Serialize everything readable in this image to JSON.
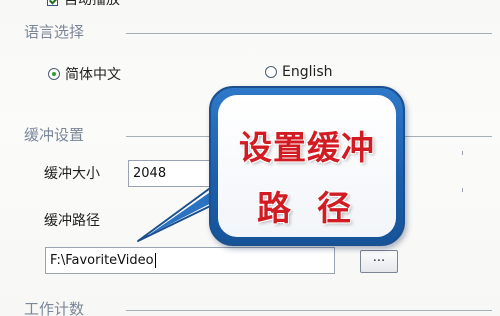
{
  "settings": {
    "top_option": {
      "label": "自动播放"
    },
    "language": {
      "header": "语言选择",
      "options": [
        {
          "label": "简体中文",
          "selected": true
        },
        {
          "label": "English",
          "selected": false
        }
      ]
    },
    "buffer": {
      "header": "缓冲设置",
      "size_label": "缓冲大小",
      "size_value": "2048",
      "path_label": "缓冲路径",
      "path_value": "F:\\FavoriteVideo",
      "browse_label": "..."
    },
    "next_section": {
      "header": "工作计数"
    }
  },
  "annotation": {
    "line1": "设置缓冲",
    "line2": "路径",
    "text_color": "#d21c24",
    "frame_color": "#1f63b0"
  },
  "colors": {
    "section_header": "#7b8798",
    "radio_checked": "#2f9d2f"
  }
}
